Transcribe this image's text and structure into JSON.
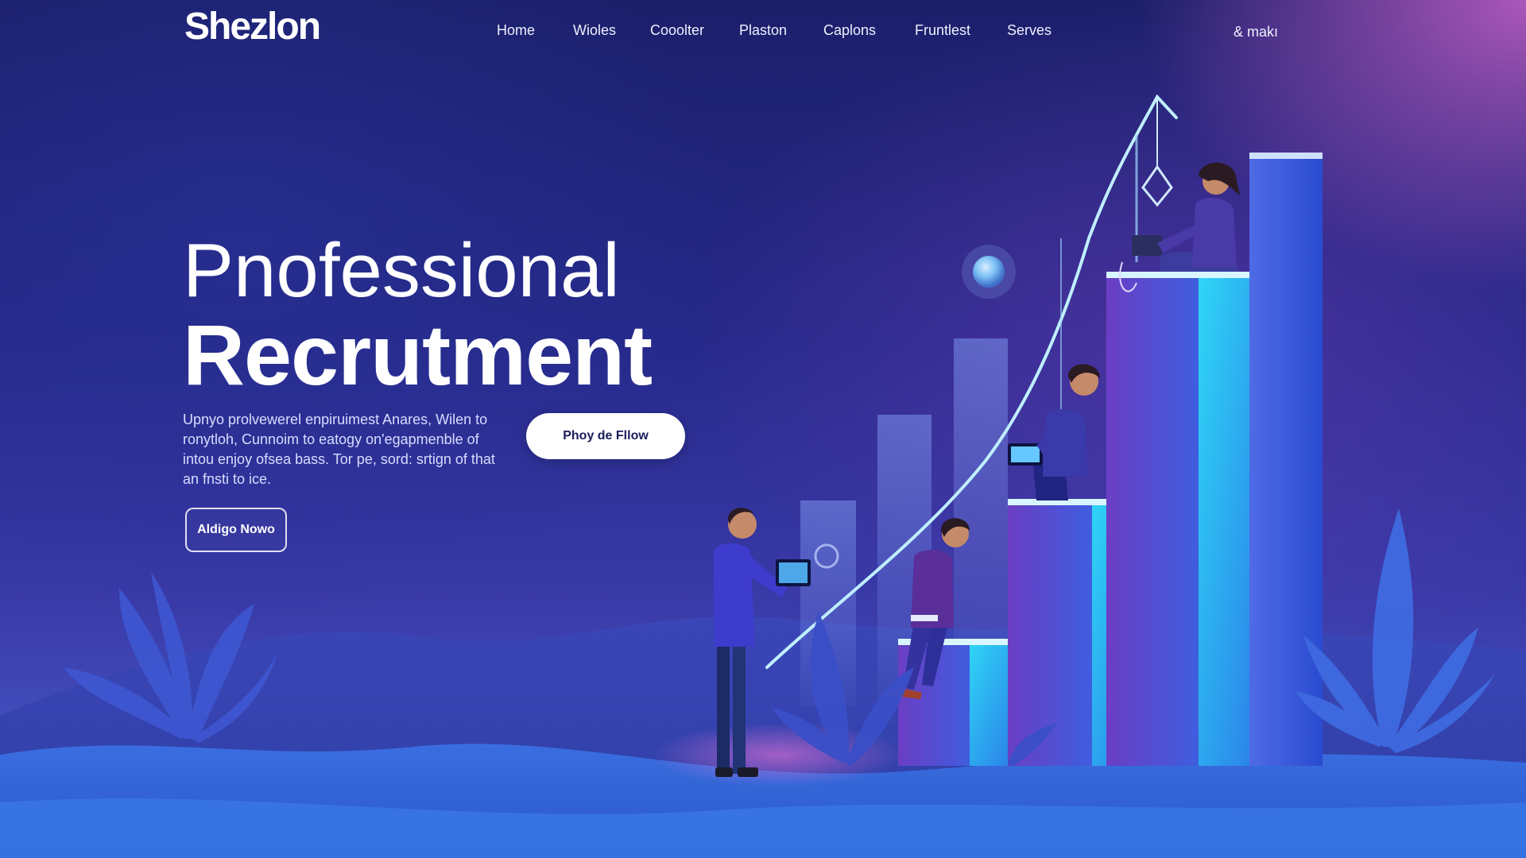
{
  "brand": {
    "logo_text": "Shezlon"
  },
  "nav": {
    "items": [
      {
        "label": "Home"
      },
      {
        "label": "Wioles"
      },
      {
        "label": "Cooolter"
      },
      {
        "label": "Plaston"
      },
      {
        "label": "Caplons"
      },
      {
        "label": "Fruntlest"
      },
      {
        "label": "Serves"
      }
    ],
    "right_label": "& makı"
  },
  "hero": {
    "title_line1": "Pnofessional",
    "title_line2": "Recrutment",
    "body_lines": [
      "Upnyo prolvewerel enpiruimest Anares, Wilen to",
      "ronytloh, Cunnoim to eatogy on'egapmenble of",
      "intou enjoy ofsea bass. Tor pe, sord: srtign of that",
      "an fnsti to ice."
    ],
    "primary_cta": "Phoy de Fllow",
    "secondary_cta": "Aldigo Nowo"
  },
  "colors": {
    "background_top": "#1b1f6a",
    "background_bottom": "#4a62d0",
    "accent_pink": "#c460c8",
    "bar_cyan": "#22c9f2",
    "bar_purple": "#6c3ec4",
    "growth_line": "#bfefff"
  },
  "icons": {
    "planet": "globe-icon",
    "tag": "price-tag-icon"
  }
}
